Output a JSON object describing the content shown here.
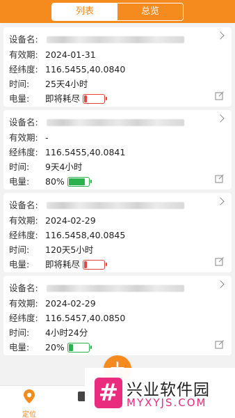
{
  "tabs": {
    "list": "列表",
    "overview": "总览"
  },
  "labels": {
    "device_name": "设备名:",
    "valid_until": "有效期:",
    "coords": "经纬度:",
    "time": "时间:",
    "battery": "电量:"
  },
  "devices": [
    {
      "valid_until": "2024-01-31",
      "coords": "116.5455,40.0840",
      "time": "25天4小时",
      "battery_text": "即将耗尽",
      "battery_level": 0.1,
      "battery_color": "#e8433a"
    },
    {
      "valid_until": "-",
      "coords": "116.5455,40.0841",
      "time": "9天4小时",
      "battery_text": "80%",
      "battery_level": 0.8,
      "battery_color": "#2bb24c"
    },
    {
      "valid_until": "2024-02-29",
      "coords": "116.5458,40.0845",
      "time": "120天5小时",
      "battery_text": "即将耗尽",
      "battery_level": 0.1,
      "battery_color": "#e8433a"
    },
    {
      "valid_until": "2024-02-29",
      "coords": "116.5457,40.0850",
      "time": "4小时24分",
      "battery_text": "20%",
      "battery_level": 0.2,
      "battery_color": "#2bb24c"
    }
  ],
  "fab": {
    "icon": "plus-icon",
    "symbol": "+"
  },
  "bottom_nav": [
    {
      "label": "定位",
      "icon": "location-pin-icon",
      "active": true
    }
  ],
  "watermark": {
    "logo": "#",
    "title": "兴业软件园",
    "subtitle": "MYXYJS.COM"
  },
  "colors": {
    "accent": "#f58a1f",
    "low_battery": "#e8433a",
    "ok_battery": "#2bb24c",
    "watermark_pink": "#ea2c7f"
  }
}
